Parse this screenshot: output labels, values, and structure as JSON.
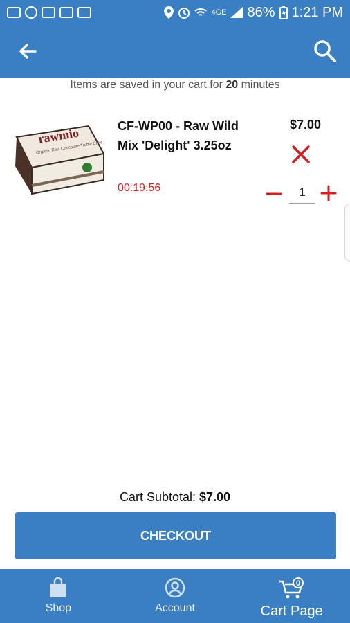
{
  "status": {
    "battery": "86%",
    "time": "1:21 PM",
    "network_tag": "4GE"
  },
  "notice": {
    "prefix": "Items are saved in your cart for ",
    "minutes": "20",
    "suffix": " minutes"
  },
  "item": {
    "name": "CF-WP00 - Raw Wild Mix 'Delight' 3.25oz",
    "timer": "00:19:56",
    "price": "$7.00",
    "quantity": "1",
    "image_brand": "rawmio",
    "image_subtitle": "Organic Raw Chocolate Truffle Cake"
  },
  "summary": {
    "subtotal_label": "Cart Subtotal:",
    "subtotal_value": "$7.00"
  },
  "checkout_label": "CHECKOUT",
  "nav": {
    "shop": "Shop",
    "account": "Account",
    "cart": "Cart Page",
    "cart_badge": "0"
  },
  "colors": {
    "primary": "#3a7fc4",
    "danger": "#d21f1f"
  }
}
